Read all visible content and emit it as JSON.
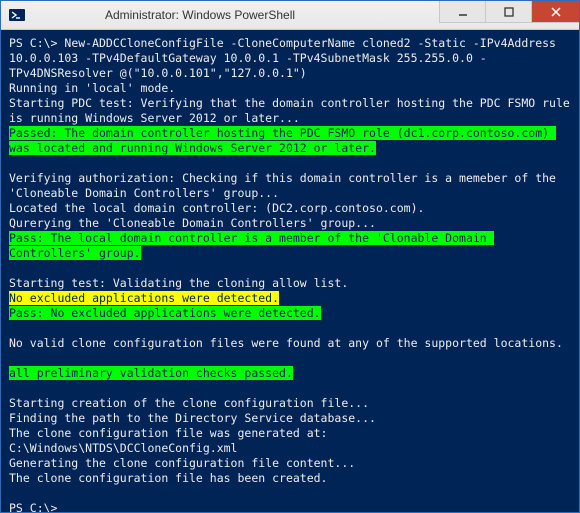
{
  "window": {
    "title": "Administrator: Windows PowerShell",
    "icon": "powershell-icon"
  },
  "console": {
    "prompt1": "PS C:\\> ",
    "command": "New-ADDCCloneConfigFile -CloneComputerName cloned2 -Static -IPv4Address 10.0.0.103 -TPv4DefaultGateway 10.0.0.1 -TPv4SubnetMask 255.255.0.0 -TPv4DNSResolver @(\"10.0.0.101\",\"127.0.0.1\")",
    "l1": "Running in 'local' mode.",
    "l2": "Starting PDC test: Verifying that the domain controller hosting the PDC FSMO rule is running Windows Server 2012 or later...",
    "pass1": "Passed: The domain controller hosting the PDC FSMO role (dc1.corp.contoso.com) was located and running Windows Server 2012 or later.",
    "l3": "Verifying authorization: Checking if this domain controller is a memeber of the 'Cloneable Domain Controllers' group...",
    "l4": "Located the local domain controller: (DC2.corp.contoso.com).",
    "l5": "Qurerying the 'Cloneable Domain Controllers' group...",
    "pass2": "Pass: The local domain controller is a member of the 'Clonable Domain Controllers' group.",
    "l6": "Starting test: Validating the cloning allow list.",
    "warn1": "No excluded applications were detected.",
    "pass3": "Pass: No excluded applications were detected.",
    "l7": "No valid clone configuration files were found at any of the supported locations.",
    "pass4": "all preliminary validation checks passed.",
    "l8": "Starting creation of the clone configuration file...",
    "l9": "Finding the path to the Directory Service database...",
    "l10": "The clone configuration file was generated at:",
    "l11": "C:\\Windows\\NTDS\\DCCloneConfig.xml",
    "l12": "Generating the clone configuration file content...",
    "l13": "The clone configuration file has been created.",
    "prompt2": "PS C:\\> "
  }
}
